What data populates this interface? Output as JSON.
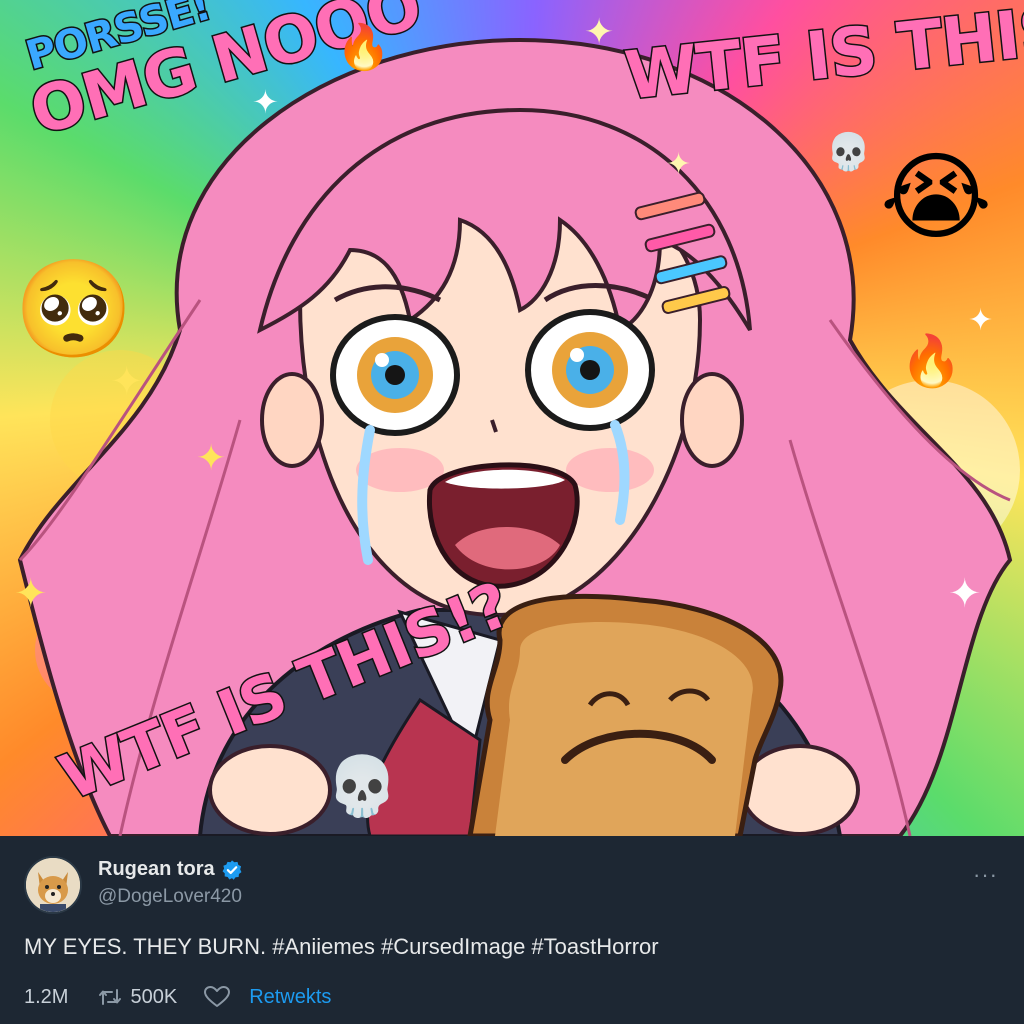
{
  "meme": {
    "captions": {
      "porsse": "PORSSE!",
      "omg": "OMG NOOO",
      "wtf_top": "WTF IS THIS!?",
      "wtf_bottom": "WTF IS THIS!?"
    },
    "emojis": {
      "fire": "🔥",
      "skull": "💀",
      "crying": "😭",
      "pleading": "🥺",
      "sparkle": "✦"
    },
    "colors": {
      "hair": "#f58bbf",
      "caption_pink": "#ff6fb6",
      "caption_blue": "#3aa8ff",
      "toast": "#c9823a"
    }
  },
  "tweet": {
    "display_name": "Rugean tora",
    "handle": "@DogeLover420",
    "verified": true,
    "more_icon": "···",
    "text": "MY EYES. THEY BURN. #Aniiemes #CursedImage #ToastHorror",
    "stats": {
      "views": "1.2M",
      "retweets": "500K",
      "link_label": "Retwekts"
    },
    "colors": {
      "background": "#1d2733",
      "link": "#1d9bf0",
      "muted": "#8b98a5"
    }
  }
}
